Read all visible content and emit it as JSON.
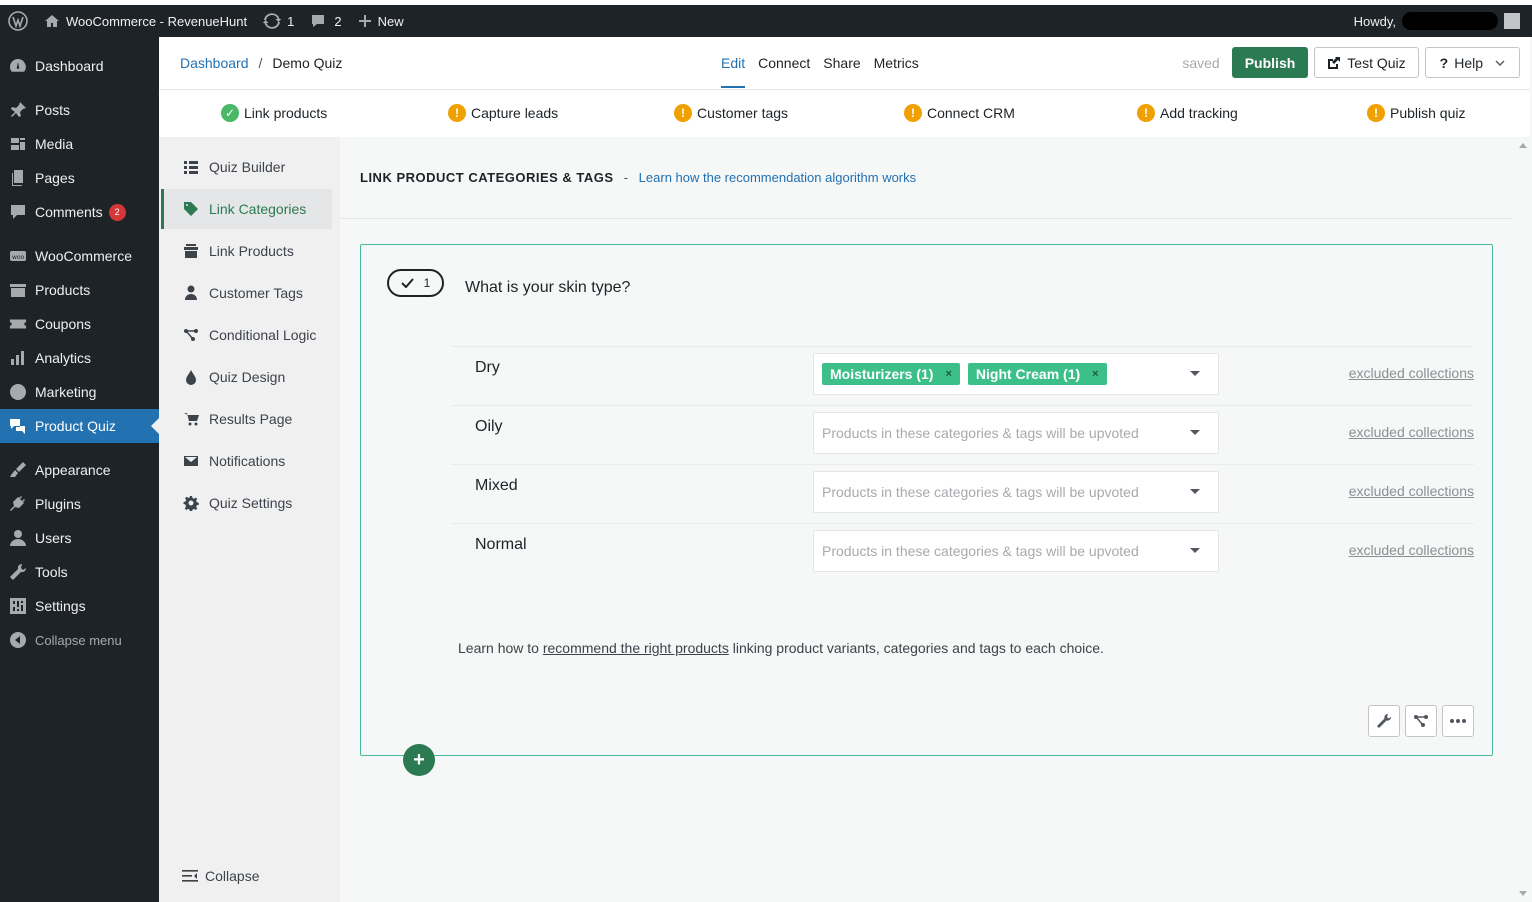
{
  "adminbar": {
    "site_name": "WooCommerce - RevenueHunt",
    "updates_count": "1",
    "comments_count": "2",
    "new_label": "New",
    "howdy": "Howdy,"
  },
  "adminmenu": {
    "items": [
      {
        "label": "Dashboard",
        "icon": "dashboard-icon"
      },
      {
        "label": "Posts",
        "icon": "pin-icon"
      },
      {
        "label": "Media",
        "icon": "media-icon"
      },
      {
        "label": "Pages",
        "icon": "pages-icon"
      },
      {
        "label": "Comments",
        "icon": "comment-icon",
        "badge": "2"
      },
      {
        "label": "WooCommerce",
        "icon": "woo-icon"
      },
      {
        "label": "Products",
        "icon": "archive-icon"
      },
      {
        "label": "Coupons",
        "icon": "ticket-icon"
      },
      {
        "label": "Analytics",
        "icon": "bar-chart-icon"
      },
      {
        "label": "Marketing",
        "icon": "megaphone-icon"
      },
      {
        "label": "Product Quiz",
        "icon": "quiz-icon",
        "current": true
      },
      {
        "label": "Appearance",
        "icon": "brush-icon"
      },
      {
        "label": "Plugins",
        "icon": "plug-icon"
      },
      {
        "label": "Users",
        "icon": "user-icon"
      },
      {
        "label": "Tools",
        "icon": "wrench-icon"
      },
      {
        "label": "Settings",
        "icon": "settings-icon"
      }
    ],
    "collapse_label": "Collapse menu"
  },
  "header": {
    "breadcrumb_root": "Dashboard",
    "breadcrumb_sep": "/",
    "breadcrumb_current": "Demo Quiz",
    "tabs": [
      "Edit",
      "Connect",
      "Share",
      "Metrics"
    ],
    "active_tab": "Edit",
    "saved_label": "saved",
    "publish_label": "Publish",
    "test_label": "Test Quiz",
    "help_label": "Help"
  },
  "steps": [
    {
      "label": "Link products",
      "status": "done"
    },
    {
      "label": "Capture leads",
      "status": "todo"
    },
    {
      "label": "Customer tags",
      "status": "todo"
    },
    {
      "label": "Connect CRM",
      "status": "todo"
    },
    {
      "label": "Add tracking",
      "status": "todo"
    },
    {
      "label": "Publish quiz",
      "status": "todo"
    }
  ],
  "subnav": {
    "items": [
      {
        "label": "Quiz Builder",
        "icon": "list-icon"
      },
      {
        "label": "Link Categories",
        "icon": "tag-icon",
        "active": true
      },
      {
        "label": "Link Products",
        "icon": "box-icon"
      },
      {
        "label": "Customer Tags",
        "icon": "user-icon"
      },
      {
        "label": "Conditional Logic",
        "icon": "branch-icon"
      },
      {
        "label": "Quiz Design",
        "icon": "drop-icon"
      },
      {
        "label": "Results Page",
        "icon": "cart-icon"
      },
      {
        "label": "Notifications",
        "icon": "envelope-icon"
      },
      {
        "label": "Quiz Settings",
        "icon": "gear-icon"
      }
    ],
    "collapse_label": "Collapse"
  },
  "main": {
    "section_title": "LINK PRODUCT CATEGORIES & TAGS",
    "section_dash": "-",
    "section_link": "Learn how the recommendation algorithm works",
    "question": {
      "number": "1",
      "title": "What is your skin type?",
      "choices": [
        {
          "label": "Dry",
          "chips": [
            "Moisturizers (1)",
            "Night Cream (1)"
          ],
          "placeholder": "",
          "excluded": "excluded collections"
        },
        {
          "label": "Oily",
          "chips": [],
          "placeholder": "Products in these categories & tags will be upvoted",
          "excluded": "excluded collections"
        },
        {
          "label": "Mixed",
          "chips": [],
          "placeholder": "Products in these categories & tags will be upvoted",
          "excluded": "excluded collections"
        },
        {
          "label": "Normal",
          "chips": [],
          "placeholder": "Products in these categories & tags will be upvoted",
          "excluded": "excluded collections"
        }
      ]
    },
    "help_prefix": "Learn how to",
    "help_link": "recommend the right products",
    "help_suffix": "linking product variants, categories and tags to each choice.",
    "chip_remove": "×",
    "add_label": "+"
  },
  "colors": {
    "accent_blue": "#2271b1",
    "brand_green": "#2c7a52",
    "chip_green": "#3dbf8a",
    "warn_orange": "#f0a000",
    "ok_green": "#4ab866"
  }
}
